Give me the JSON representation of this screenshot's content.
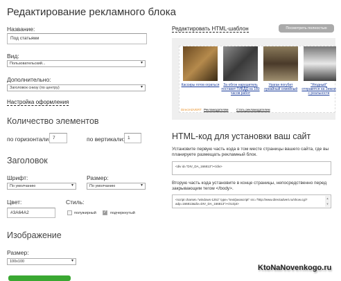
{
  "title": "Редактирование рекламного блока",
  "name_label": "Название:",
  "name_value": "Под статьями",
  "type_label": "Вид:",
  "type_value": "Пользовательский...",
  "extra_label": "Дополнительно:",
  "extra_value": "Заголовок снизу (по центру)",
  "design_link": "Настройка оформления",
  "count_heading": "Количество элементов",
  "horiz_label": "по горизонтали:",
  "horiz_value": "7",
  "vert_label": "по вертикали:",
  "vert_value": "1",
  "header_heading": "Заголовок",
  "font_label": "Шрифт:",
  "font_value": "По умолчанию",
  "size_label": "Размер:",
  "size_value": "По умолчанию",
  "color_label": "Цвет:",
  "color_value": "#3A64A2",
  "style_label": "Стиль:",
  "bold_label": "полужирный",
  "underline_label": "подчеркнутый",
  "image_heading": "Изображение",
  "image_size_label": "Размер:",
  "image_size_value": "100x100",
  "edit_html_link": "Редактировать HTML-шаблон",
  "view_fullscreen_button": "Посмотреть полностью",
  "preview": {
    "items": [
      "Кассиры готов ограться",
      "За обгон нарушитель поставит ГИБДД на 180 часов работ",
      "Ураган погубит лужайный семейный",
      "\"Ягодный\" отправятся на Земли с реальности"
    ],
    "footer": [
      "DirectADVERT",
      "Рекламодателям",
      "Стать рекламодателем"
    ]
  },
  "code_heading": "HTML-код для установки ваш сайт",
  "code_hint1": "Установите первую часть кода в том месте страницы вашего сайта, где вы планируете размещать рекламный блок.",
  "code1": "<div id=\"DIV_DA_166813\"></div>",
  "code_hint2": "Вторую часть кода установите в конце страницы, непосредственно перед закрывающим тегом </body>.",
  "code2": "<script charset=\"windows-1251\" type=\"text/javascript\" src=\"http://www.directadvert.ru/show.cgi?adp=166813&div=DIV_DA_166813\"></script>",
  "watermark": "KtoNaNovenkogo.ru"
}
